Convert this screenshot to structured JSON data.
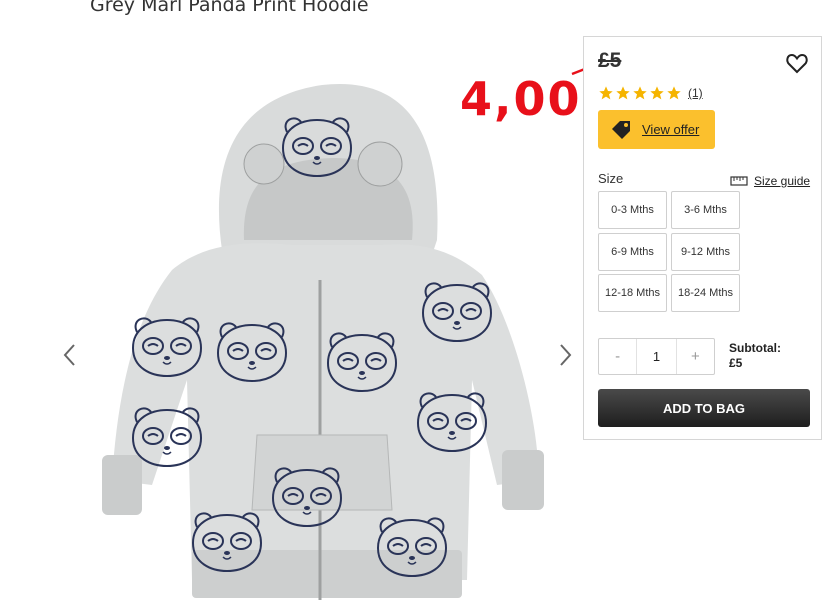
{
  "product": {
    "title": "Grey Marl Panda Print Hoodie"
  },
  "annotation": {
    "handwritten_price": "4,00"
  },
  "panel": {
    "old_price": "£5",
    "rating": {
      "stars": 5,
      "max_stars": 5,
      "review_count": "(1)"
    },
    "offer_label": "View offer",
    "size_label": "Size",
    "size_guide_label": "Size guide",
    "sizes": [
      "0-3 Mths",
      "3-6 Mths",
      "6-9 Mths",
      "9-12 Mths",
      "12-18 Mths",
      "18-24 Mths"
    ],
    "quantity": {
      "minus": "-",
      "value": "1",
      "plus": "+"
    },
    "subtotal_label": "Subtotal:",
    "subtotal_value": "£5",
    "add_to_bag_label": "ADD TO BAG"
  },
  "icons": [
    "chevron-left-icon",
    "chevron-right-icon",
    "heart-icon",
    "star-icon",
    "price-tag-icon",
    "ruler-icon"
  ],
  "colors": {
    "offer": "#fbc02d",
    "stars": "#f5b400",
    "annotation": "#e8101a",
    "button": "#2a2a2a"
  }
}
